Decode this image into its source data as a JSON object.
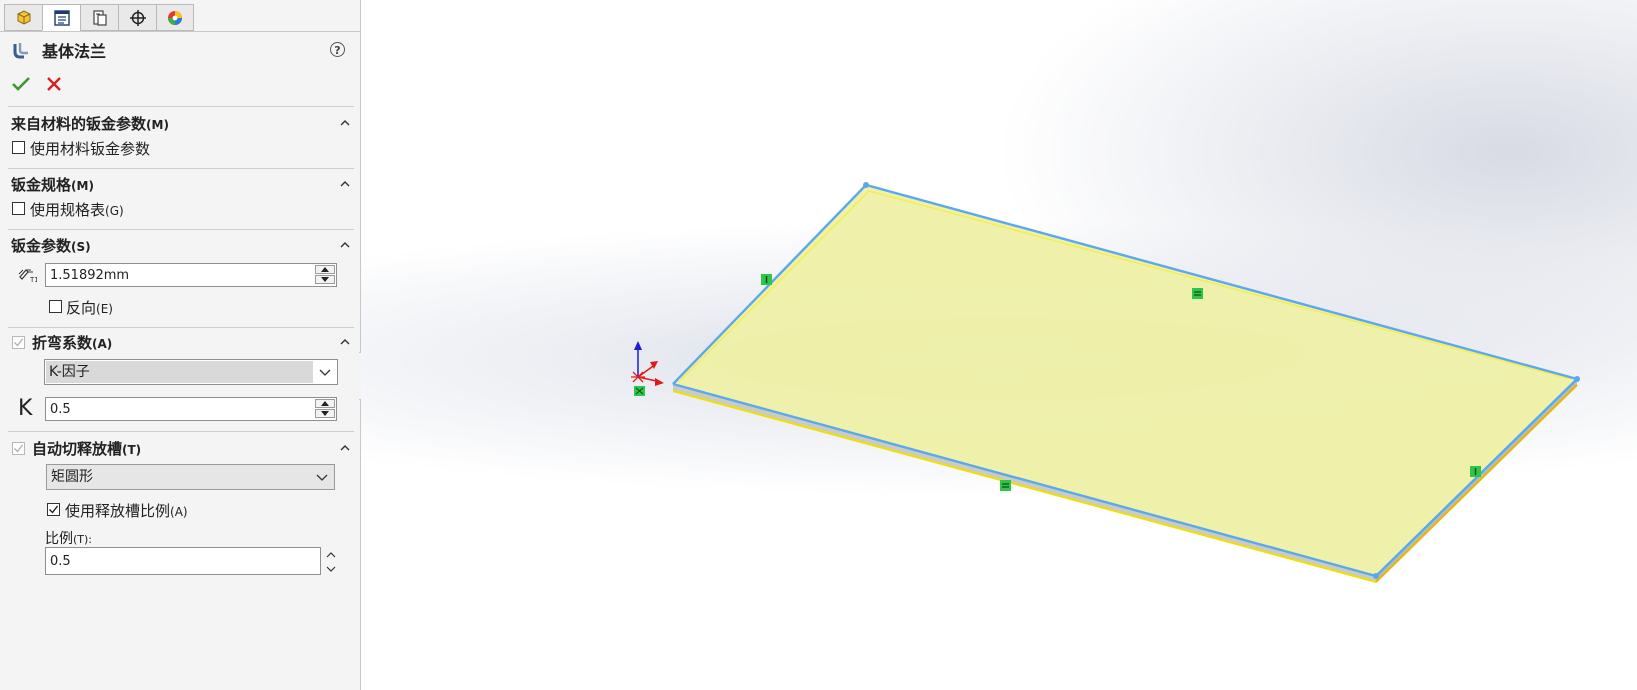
{
  "panel": {
    "tabs": [
      {
        "name": "feature-manager-icon"
      },
      {
        "name": "property-manager-icon"
      },
      {
        "name": "configuration-manager-icon"
      },
      {
        "name": "dimxpert-manager-icon"
      },
      {
        "name": "display-manager-icon"
      }
    ],
    "title": "基体法兰",
    "help": "?",
    "sections": {
      "material": {
        "title": "来自材料的钣金参数",
        "mnemonic": "(M)",
        "checkbox_label": "使用材料钣金参数",
        "checked": false
      },
      "gauge": {
        "title": "钣金规格",
        "mnemonic": "(M)",
        "checkbox_label": "使用规格表",
        "checkbox_mnemonic": "(G)",
        "checked": false
      },
      "params": {
        "title": "钣金参数",
        "mnemonic": "(S)",
        "thickness": "1.51892mm",
        "reverse_label": "反向",
        "reverse_mnemonic": "(E)",
        "reverse_checked": false
      },
      "bend": {
        "title": "折弯系数",
        "mnemonic": "(A)",
        "type": "K-因子",
        "k_label": "K",
        "k_value": "0.5"
      },
      "relief": {
        "title": "自动切释放槽",
        "mnemonic": "(T)",
        "type": "矩圆形",
        "ratio_checkbox_label": "使用释放槽比例",
        "ratio_checkbox_mnemonic": "(A)",
        "ratio_checked": true,
        "ratio_label": "比例",
        "ratio_mnemonic": "(T):",
        "ratio_value": "0.5"
      }
    }
  },
  "colors": {
    "plate_fill": "#eef0a6",
    "plate_edge": "#5aa9ec",
    "relation_marker": "#2fc44a",
    "ok": "#3a9a2a",
    "cancel": "#d42020"
  }
}
